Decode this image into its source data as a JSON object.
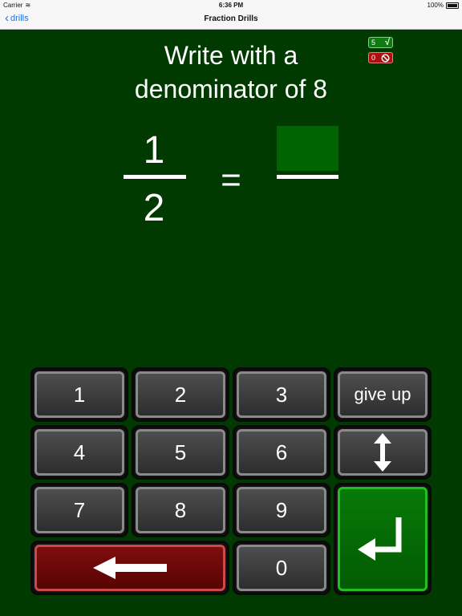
{
  "status_bar": {
    "carrier": "Carrier",
    "time": "6:36 PM",
    "battery": "100%"
  },
  "nav": {
    "back_label": "drills",
    "title": "Fraction Drills"
  },
  "prompt": {
    "line1": "Write with a",
    "line2": "denominator of 8"
  },
  "score": {
    "correct": "5",
    "wrong": "0"
  },
  "fraction": {
    "numerator": "1",
    "denominator": "2",
    "equals": "="
  },
  "keypad": {
    "k1": "1",
    "k2": "2",
    "k3": "3",
    "give_up": "give up",
    "k4": "4",
    "k5": "5",
    "k6": "6",
    "k7": "7",
    "k8": "8",
    "k9": "9",
    "k0": "0"
  },
  "colors": {
    "background": "#013a01",
    "answer_box": "#006400",
    "backspace": "#7e0d0d",
    "enter": "#077a07"
  },
  "icons": {
    "back": "chevron-left-icon",
    "correct": "checkmark-icon",
    "wrong": "no-entry-icon",
    "swap": "vertical-arrows-icon",
    "backspace": "left-arrow-icon",
    "enter": "return-icon"
  }
}
